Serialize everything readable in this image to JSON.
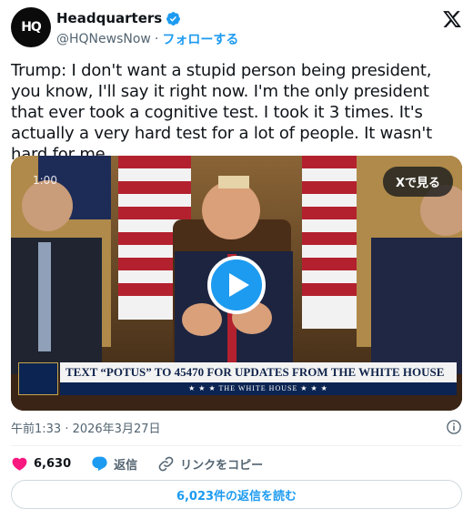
{
  "account": {
    "avatar_text": "HQ",
    "name": "Headquarters",
    "handle": "@HQNewsNow",
    "separator": "·",
    "follow_label": "フォローする"
  },
  "tweet": {
    "text": "Trump: I don't want a stupid person being president, you know, I'll say it right now. I'm the only president that ever took a cognitive test. I took it 3 times. It's actually a very hard test for a lot of people. It wasn't hard for me"
  },
  "video": {
    "timecode": "1:00",
    "watch_on_x_label": "Xで見る",
    "banner_text": "TEXT “POTUS” TO 45470 FOR UPDATES FROM THE WHITE HOUSE",
    "banner_sub": "★ ★ ★   THE WHITE HOUSE   ★ ★ ★"
  },
  "meta": {
    "timestamp": "午前1:33 · 2026年3月27日"
  },
  "actions": {
    "likes": "6,630",
    "reply_label": "返信",
    "copy_link_label": "リンクをコピー"
  },
  "read_replies_label": "6,023件の返信を読む",
  "colors": {
    "accent": "#1d9bf0",
    "like": "#f91880",
    "text": "#0f1419",
    "muted": "#536471"
  },
  "icons": [
    "verified-badge-icon",
    "x-logo-icon",
    "play-icon",
    "info-icon",
    "heart-icon",
    "reply-bubble-icon",
    "link-icon"
  ]
}
